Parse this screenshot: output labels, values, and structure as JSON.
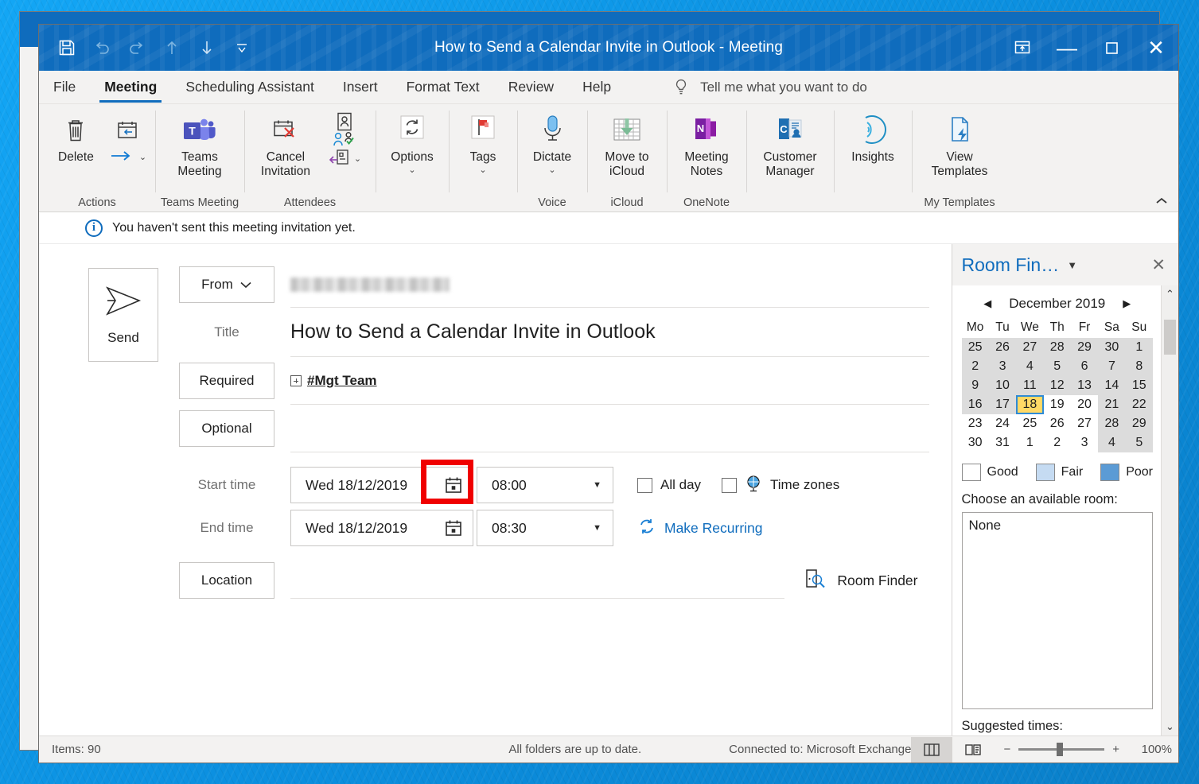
{
  "window": {
    "title": "How to Send a Calendar Invite in Outlook  -  Meeting",
    "quick_access": [
      "save-icon",
      "undo-icon",
      "redo-icon",
      "up-icon",
      "down-icon",
      "customize-qat-icon"
    ],
    "controls": {
      "ribbon_display": "ribbon-display-options-icon",
      "minimize": "—",
      "maximize": "▢",
      "close": "✕"
    }
  },
  "tabs": [
    {
      "label": "File",
      "active": false
    },
    {
      "label": "Meeting",
      "active": true
    },
    {
      "label": "Scheduling Assistant",
      "active": false
    },
    {
      "label": "Insert",
      "active": false
    },
    {
      "label": "Format Text",
      "active": false
    },
    {
      "label": "Review",
      "active": false
    },
    {
      "label": "Help",
      "active": false
    }
  ],
  "tell_me": {
    "icon": "lightbulb-icon",
    "placeholder": "Tell me what you want to do"
  },
  "ribbon": {
    "groups": [
      {
        "name": "Actions",
        "label": "Actions",
        "buttons": [
          {
            "label": "Delete",
            "icon": "trash-icon"
          },
          {
            "label": "",
            "icon": "forward-icon",
            "has_caret": true
          }
        ]
      },
      {
        "name": "Teams Meeting",
        "label": "Teams Meeting",
        "buttons": [
          {
            "label": "Teams\nMeeting",
            "icon": "teams-icon"
          }
        ]
      },
      {
        "name": "Attendees",
        "label": "Attendees",
        "buttons": [
          {
            "label": "Cancel\nInvitation",
            "icon": "cancel-invitation-icon"
          },
          {
            "label": "",
            "icon": "address-book-icon",
            "has_caret": true
          }
        ]
      },
      {
        "name": "Options",
        "label": "",
        "buttons": [
          {
            "label": "Options",
            "icon": "options-icon",
            "has_caret": true
          }
        ]
      },
      {
        "name": "Tags",
        "label": "",
        "buttons": [
          {
            "label": "Tags",
            "icon": "flag-icon",
            "has_caret": true
          }
        ]
      },
      {
        "name": "Voice",
        "label": "Voice",
        "buttons": [
          {
            "label": "Dictate",
            "icon": "microphone-icon",
            "has_caret": true
          }
        ]
      },
      {
        "name": "iCloud",
        "label": "iCloud",
        "buttons": [
          {
            "label": "Move to\niCloud",
            "icon": "move-to-icloud-icon"
          }
        ]
      },
      {
        "name": "OneNote",
        "label": "OneNote",
        "buttons": [
          {
            "label": "Meeting\nNotes",
            "icon": "onenote-icon"
          }
        ]
      },
      {
        "name": "Customer Manager",
        "label": "",
        "buttons": [
          {
            "label": "Customer\nManager",
            "icon": "customer-manager-icon"
          }
        ]
      },
      {
        "name": "Insights",
        "label": "",
        "buttons": [
          {
            "label": "Insights",
            "icon": "insights-icon"
          }
        ]
      },
      {
        "name": "My Templates",
        "label": "My Templates",
        "buttons": [
          {
            "label": "View\nTemplates",
            "icon": "view-templates-icon"
          }
        ]
      }
    ],
    "collapse_icon": "chevron-up-icon"
  },
  "info_bar": {
    "icon": "info-icon",
    "text": "You haven't sent this meeting invitation yet."
  },
  "form": {
    "send_label": "Send",
    "send_icon": "send-arrow-icon",
    "from_label": "From",
    "from_value": "",
    "title_label": "Title",
    "title_value": "How to Send a Calendar Invite in Outlook",
    "required_label": "Required",
    "required_value": "#Mgt Team",
    "optional_label": "Optional",
    "optional_value": "",
    "start_time_label": "Start time",
    "start_date": "Wed 18/12/2019",
    "start_time": "08:00",
    "end_time_label": "End time",
    "end_date": "Wed 18/12/2019",
    "end_time": "08:30",
    "all_day_label": "All day",
    "all_day_checked": false,
    "time_zones_label": "Time zones",
    "time_zones_checked": false,
    "time_zones_icon": "globe-icon",
    "make_recurring_label": "Make Recurring",
    "make_recurring_icon": "recurring-icon",
    "location_label": "Location",
    "location_value": "",
    "room_finder_label": "Room Finder",
    "room_finder_icon": "room-finder-icon",
    "highlight_target": "start-date-calendar-picker-button",
    "highlight_color": "#f00000"
  },
  "room_finder": {
    "title": "Room Fin…",
    "caret_icon": "chevron-down-icon",
    "close_icon": "close-icon",
    "calendar": {
      "month_label": "December 2019",
      "prev_icon": "prev-month-arrow",
      "next_icon": "next-month-arrow",
      "weekday_headers": [
        "Mo",
        "Tu",
        "We",
        "Th",
        "Fr",
        "Sa",
        "Su"
      ],
      "weeks": [
        [
          {
            "d": "25",
            "other": true,
            "busy": true
          },
          {
            "d": "26",
            "other": true,
            "busy": true
          },
          {
            "d": "27",
            "other": true,
            "busy": true
          },
          {
            "d": "28",
            "other": true,
            "busy": true
          },
          {
            "d": "29",
            "other": true,
            "busy": true
          },
          {
            "d": "30",
            "other": true,
            "busy": true
          },
          {
            "d": "1",
            "other": false,
            "busy": true
          }
        ],
        [
          {
            "d": "2",
            "busy": true
          },
          {
            "d": "3",
            "busy": true
          },
          {
            "d": "4",
            "busy": true
          },
          {
            "d": "5",
            "busy": true
          },
          {
            "d": "6",
            "busy": true
          },
          {
            "d": "7",
            "busy": true
          },
          {
            "d": "8",
            "busy": true
          }
        ],
        [
          {
            "d": "9",
            "busy": true
          },
          {
            "d": "10",
            "busy": true
          },
          {
            "d": "11",
            "busy": true
          },
          {
            "d": "12",
            "busy": true
          },
          {
            "d": "13",
            "busy": true
          },
          {
            "d": "14",
            "busy": true
          },
          {
            "d": "15",
            "busy": true
          }
        ],
        [
          {
            "d": "16",
            "busy": true
          },
          {
            "d": "17",
            "busy": true
          },
          {
            "d": "18",
            "selected": true
          },
          {
            "d": "19",
            "busy": false
          },
          {
            "d": "20",
            "busy": false
          },
          {
            "d": "21",
            "busy": true
          },
          {
            "d": "22",
            "busy": true
          }
        ],
        [
          {
            "d": "23",
            "busy": false
          },
          {
            "d": "24",
            "busy": false
          },
          {
            "d": "25",
            "busy": false
          },
          {
            "d": "26",
            "busy": false
          },
          {
            "d": "27",
            "busy": false
          },
          {
            "d": "28",
            "busy": true
          },
          {
            "d": "29",
            "busy": true
          }
        ],
        [
          {
            "d": "30",
            "busy": false
          },
          {
            "d": "31",
            "busy": false
          },
          {
            "d": "1",
            "nextmonth": true
          },
          {
            "d": "2",
            "nextmonth": true
          },
          {
            "d": "3",
            "nextmonth": true
          },
          {
            "d": "4",
            "nextmonth": true,
            "busy": true
          },
          {
            "d": "5",
            "nextmonth": true,
            "busy": true
          }
        ]
      ]
    },
    "legend": [
      {
        "label": "Good",
        "color": "#ffffff"
      },
      {
        "label": "Fair",
        "color": "#c5dbf2"
      },
      {
        "label": "Poor",
        "color": "#5b9bd5"
      }
    ],
    "choose_room_label": "Choose an available room:",
    "room_list": [
      "None"
    ],
    "suggested_times_label": "Suggested times:"
  },
  "status_bar": {
    "items_label": "Items: 90",
    "folders_status": "All folders are up to date.",
    "connection": "Connected to: Microsoft Exchange",
    "view_buttons": [
      "normal-view-icon",
      "reading-view-icon"
    ],
    "zoom_out_icon": "−",
    "zoom_in_icon": "+",
    "zoom_level": "100%"
  }
}
